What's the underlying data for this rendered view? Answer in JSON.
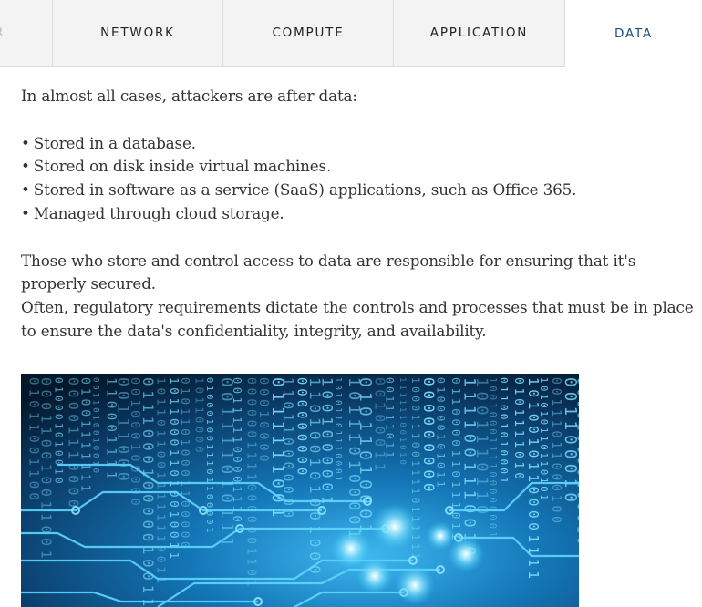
{
  "tabs": {
    "partial_label": "R",
    "items": [
      {
        "label": "NETWORK"
      },
      {
        "label": "COMPUTE"
      },
      {
        "label": "APPLICATION"
      },
      {
        "label": "DATA",
        "active": true
      }
    ]
  },
  "content": {
    "intro": "In almost all cases, attackers are after data:",
    "bullets": [
      "Stored in a database.",
      "Stored on disk inside virtual machines.",
      "Stored in software as a service (SaaS) applications, such as Office 365.",
      "Managed through cloud storage."
    ],
    "para1": "Those who store and control access to data are responsible for ensuring that it's properly secured.",
    "para2": "Often, regulatory requirements dictate the controls and processes that must be in place to ensure the data's confidentiality, integrity, and availability."
  },
  "colors": {
    "active_tab_text": "#1f4f7f",
    "tab_bg": "#f3f3f3",
    "hero_dark": "#03182c",
    "hero_glow": "#29c4f2"
  },
  "image": {
    "icon": "binary-circuit-image"
  }
}
